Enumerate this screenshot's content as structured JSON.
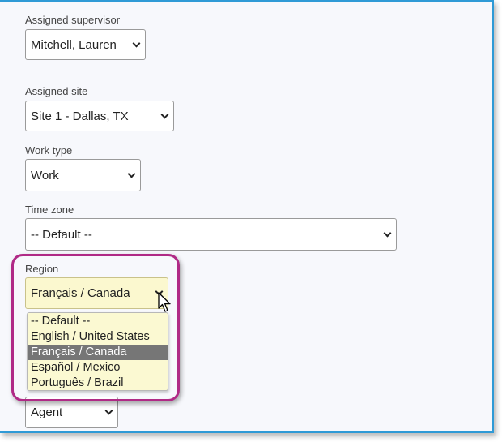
{
  "form": {
    "supervisor": {
      "label": "Assigned supervisor",
      "value": "Mitchell, Lauren"
    },
    "site": {
      "label": "Assigned site",
      "value": "Site 1 - Dallas, TX"
    },
    "work_type": {
      "label": "Work type",
      "value": "Work"
    },
    "time_zone": {
      "label": "Time zone",
      "value": "-- Default --"
    },
    "region": {
      "label": "Region",
      "value": "Français / Canada",
      "options": [
        "-- Default --",
        "English / United States",
        "Français / Canada",
        "Español / Mexico",
        "Português / Brazil"
      ],
      "selected_index": 2
    },
    "role": {
      "value": "Agent"
    }
  },
  "colors": {
    "accent_border": "#2f9ad6",
    "highlight": "#b02a86",
    "dropdown_bg": "#fbf9d2",
    "selected_option_bg": "#767676"
  },
  "icons": [
    "chevron-down-icon",
    "mouse-pointer-icon"
  ]
}
